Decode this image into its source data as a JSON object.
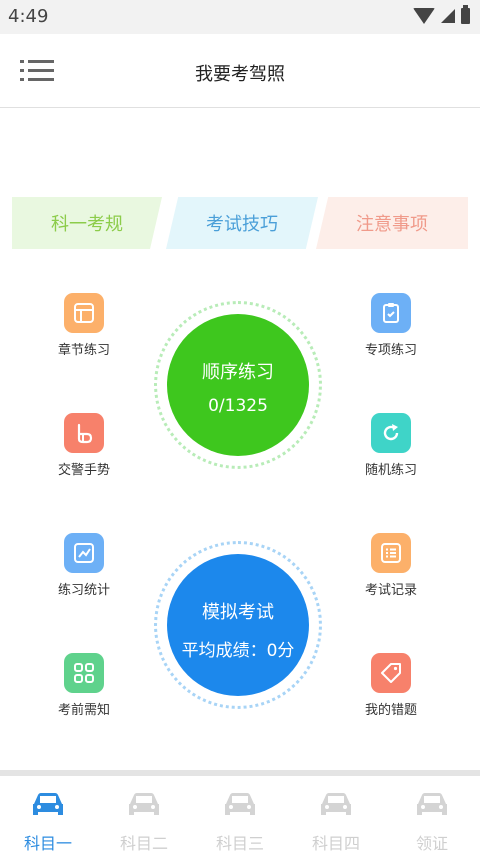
{
  "status_bar": {
    "time": "4:49"
  },
  "app_bar": {
    "title": "我要考驾照"
  },
  "cards": [
    {
      "label": "科一考规"
    },
    {
      "label": "考试技巧"
    },
    {
      "label": "注意事项"
    }
  ],
  "left_features": [
    {
      "label": "章节练习",
      "icon": "chapter-icon",
      "color": "#fcb06a"
    },
    {
      "label": "交警手势",
      "icon": "hand-gesture-icon",
      "color": "#f7816b"
    },
    {
      "label": "练习统计",
      "icon": "chart-icon",
      "color": "#6db0f6"
    },
    {
      "label": "考前需知",
      "icon": "grid-icon",
      "color": "#5fd28c"
    }
  ],
  "right_features": [
    {
      "label": "专项练习",
      "icon": "clipboard-icon",
      "color": "#6db0f6"
    },
    {
      "label": "随机练习",
      "icon": "refresh-icon",
      "color": "#3fd4c8"
    },
    {
      "label": "考试记录",
      "icon": "list-icon",
      "color": "#fcb06a"
    },
    {
      "label": "我的错题",
      "icon": "tag-icon",
      "color": "#f7816b"
    }
  ],
  "practice_circle": {
    "title": "顺序练习",
    "progress": "0/1325",
    "color": "#3ec71e"
  },
  "exam_circle": {
    "title": "模拟考试",
    "score": "平均成绩：0分",
    "color": "#1c88ec"
  },
  "tabs": [
    {
      "label": "科目一",
      "active": true
    },
    {
      "label": "科目二",
      "active": false
    },
    {
      "label": "科目三",
      "active": false
    },
    {
      "label": "科目四",
      "active": false
    },
    {
      "label": "领证",
      "active": false
    }
  ],
  "colors": {
    "accent": "#2d8ce0",
    "inactive_tab": "#cfcfcf"
  }
}
